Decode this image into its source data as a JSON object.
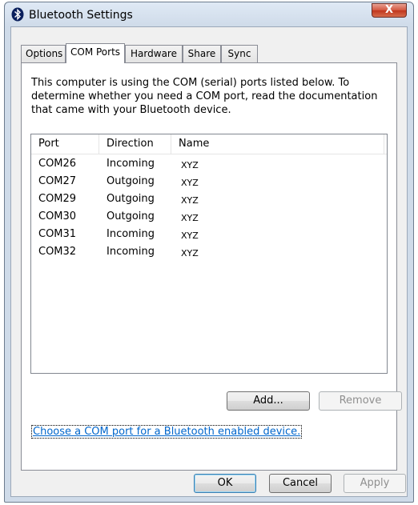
{
  "window": {
    "title": "Bluetooth Settings",
    "close_label": "X"
  },
  "tabs": [
    {
      "label": "Options"
    },
    {
      "label": "COM Ports",
      "active": true
    },
    {
      "label": "Hardware"
    },
    {
      "label": "Share"
    },
    {
      "label": "Sync"
    }
  ],
  "panel": {
    "description": "This computer is using the COM (serial) ports listed below. To determine whether you need a COM port, read the documentation that came with your Bluetooth device.",
    "columns": [
      "Port",
      "Direction",
      "Name"
    ],
    "rows": [
      {
        "port": "COM26",
        "direction": "Incoming",
        "name": "XYZ"
      },
      {
        "port": "COM27",
        "direction": "Outgoing",
        "name": "XYZ"
      },
      {
        "port": "COM29",
        "direction": "Outgoing",
        "name": "XYZ"
      },
      {
        "port": "COM30",
        "direction": "Outgoing",
        "name": "XYZ"
      },
      {
        "port": "COM31",
        "direction": "Incoming",
        "name": "XYZ"
      },
      {
        "port": "COM32",
        "direction": "Incoming",
        "name": "XYZ"
      }
    ],
    "add_label": "Add...",
    "remove_label": "Remove",
    "link_text": "Choose a COM port for a Bluetooth enabled device."
  },
  "footer": {
    "ok_label": "OK",
    "cancel_label": "Cancel",
    "apply_label": "Apply"
  },
  "icons": {
    "bluetooth": "bluetooth-icon",
    "close": "close-icon"
  },
  "colors": {
    "bluetooth": "#0a1f5c",
    "link": "#0066cc",
    "close": "#c7452a"
  }
}
